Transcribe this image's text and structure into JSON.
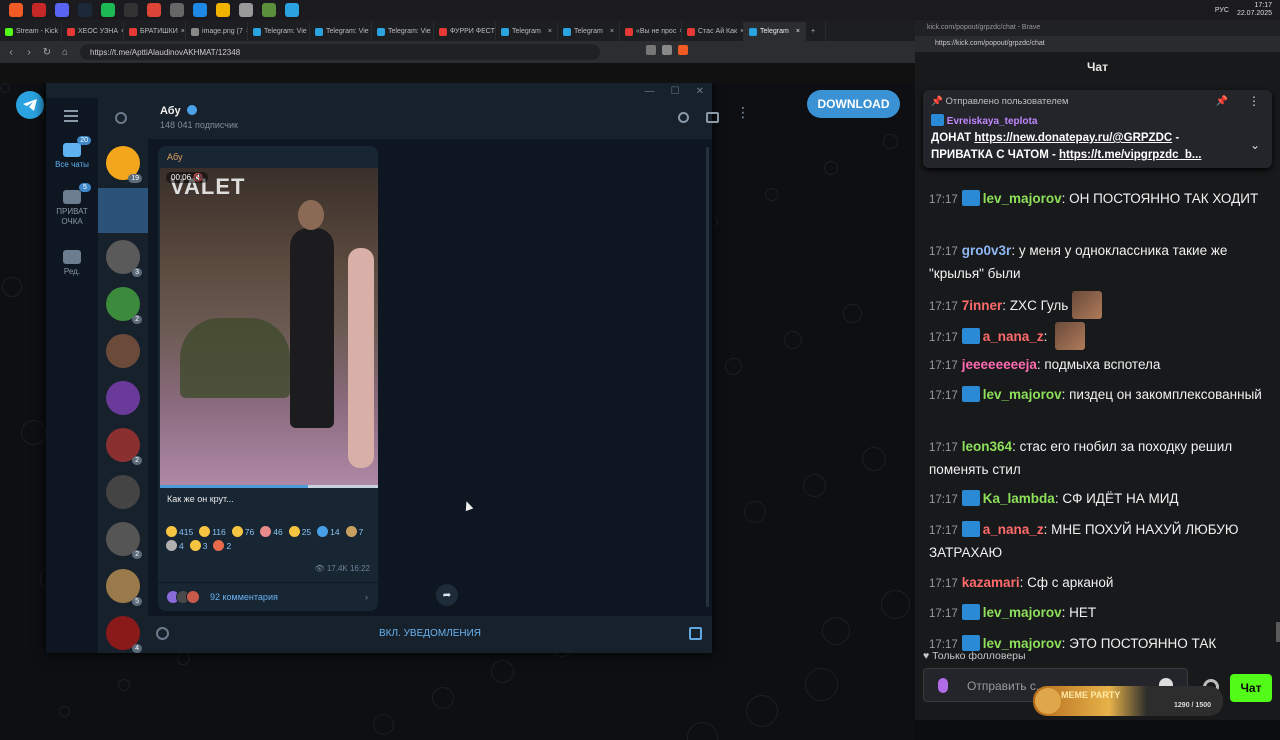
{
  "taskbar": {
    "apps": [
      {
        "name": "brave",
        "color": "#f05a24"
      },
      {
        "name": "gmail",
        "color": "#c62828"
      },
      {
        "name": "discord",
        "color": "#5865f2"
      },
      {
        "name": "steam",
        "color": "#1b2838"
      },
      {
        "name": "spotify",
        "color": "#1db954"
      },
      {
        "name": "obs",
        "color": "#333"
      },
      {
        "name": "chrome",
        "color": "#db4437"
      },
      {
        "name": "game",
        "color": "#666"
      },
      {
        "name": "bluetooth",
        "color": "#1e88e5"
      },
      {
        "name": "folder",
        "color": "#f0b400"
      },
      {
        "name": "explorer",
        "color": "#999"
      },
      {
        "name": "minecraft",
        "color": "#5b8f3b"
      },
      {
        "name": "telegram",
        "color": "#2aa3e0"
      }
    ],
    "lang": "РУС",
    "time": "17:17",
    "date": "22.07.2025"
  },
  "browser_left": {
    "tabs": [
      {
        "label": "Stream - Kick",
        "color": "#53fc18",
        "active": false
      },
      {
        "label": "ХЕОС УЗНА",
        "color": "#e53935",
        "active": false
      },
      {
        "label": "БРАТИШКИ",
        "color": "#e53935",
        "active": false
      },
      {
        "label": "image.png (7",
        "color": "#888",
        "active": false
      },
      {
        "label": "Telegram: Vie",
        "color": "#2aa3e0",
        "active": false
      },
      {
        "label": "Telegram: Vie",
        "color": "#2aa3e0",
        "active": false
      },
      {
        "label": "Telegram: Vie",
        "color": "#2aa3e0",
        "active": false
      },
      {
        "label": "ФУРРИ ФЕСТ",
        "color": "#e53935",
        "active": false
      },
      {
        "label": "Telegram",
        "color": "#2aa3e0",
        "active": false
      },
      {
        "label": "Telegram",
        "color": "#2aa3e0",
        "active": false
      },
      {
        "label": "«Вы не прос",
        "color": "#e53935",
        "active": false
      },
      {
        "label": "Стас Ай Как",
        "color": "#e53935",
        "active": false
      },
      {
        "label": "Telegram",
        "color": "#2aa3e0",
        "active": true
      }
    ],
    "url": "https://t.me/ApttiAlaudinovAKHMAT/12348"
  },
  "telegram": {
    "download_label": "DOWNLOAD",
    "folders": [
      {
        "label": "Все чаты",
        "badge": "20"
      },
      {
        "label": "ПРИВАТ ОЧКА",
        "badge": "5"
      },
      {
        "label": "Ред.",
        "badge": ""
      }
    ],
    "chat_badges": [
      "19",
      "",
      "3",
      "2",
      "",
      "",
      "2",
      "",
      "2",
      "5",
      "4"
    ],
    "chat_colors": [
      "#f3a51c",
      "#3b3b3b",
      "#5a5a5a",
      "#3c8a3c",
      "#6b4a3a",
      "#6a3a9a",
      "#8a3030",
      "#444",
      "#555",
      "#9a7a4a",
      "#8a1a1a"
    ],
    "channel_title": "Абу",
    "channel_subtitle": "148 041 подписчик",
    "post_author": "Абу",
    "video_sign": "VALET",
    "video_time": "00:06",
    "video_progress": 0.68,
    "post_text": "Как же он крут...",
    "reactions": [
      {
        "count": "415",
        "color": "#f5c542"
      },
      {
        "count": "116",
        "color": "#f5c542"
      },
      {
        "count": "76",
        "color": "#f5c542"
      },
      {
        "count": "46",
        "color": "#e88a8a"
      },
      {
        "count": "25",
        "color": "#f5c542"
      },
      {
        "count": "14",
        "color": "#4aa0e8"
      },
      {
        "count": "7",
        "color": "#c8a060"
      },
      {
        "count": "4",
        "color": "#b0b0b0"
      },
      {
        "count": "3",
        "color": "#f5c542"
      },
      {
        "count": "2",
        "color": "#e86a4a"
      }
    ],
    "views": "17.4K",
    "post_time": "16:22",
    "comments_label": "92 комментария",
    "notify_label": "ВКЛ. УВЕДОМЛЕНИЯ"
  },
  "browser_right": {
    "title": "kick.com/popout/grpzdc/chat - Brave",
    "url": "https://kick.com/popout/grpzdc/chat"
  },
  "kick": {
    "heading": "Чат",
    "pinned_by": "Отправлено пользователем",
    "pinned_user": "Evreiskaya_teplota",
    "pinned_line1_prefix": "ДОНАТ ",
    "pinned_line1_link": "https://new.donatepay.ru/@GRPZDC",
    "pinned_line1_suffix": " -",
    "pinned_line2_prefix": "ПРИВАТКА С ЧАТОМ - ",
    "pinned_line2_link": "https://t.me/vipgrpzdc_b...",
    "messages": [
      {
        "time": "17:17",
        "user": "lev_majorov",
        "color": "#8ee05a",
        "badge": true,
        "text": "ОН ПОСТОЯННО ТАК ХОДИТ",
        "emote": false
      },
      {
        "time": "17:17",
        "user": "gro0v3r",
        "color": "#8fb8f5",
        "badge": false,
        "text": "у меня у одноклассника такие же \"крылья\" были",
        "emote": false
      },
      {
        "time": "17:17",
        "user": "7inner",
        "color": "#ff6b6b",
        "badge": false,
        "text": "ZXC Гуль",
        "emote": true
      },
      {
        "time": "17:17",
        "user": "a_nana_z",
        "color": "#ff6b6b",
        "badge": true,
        "text": "",
        "emote": true
      },
      {
        "time": "17:17",
        "user": "jeeeeeeeeja",
        "color": "#ff6bb0",
        "badge": false,
        "text": "подмыха вспотела",
        "emote": false
      },
      {
        "time": "17:17",
        "user": "lev_majorov",
        "color": "#8ee05a",
        "badge": true,
        "text": "пиздец он закомплексованный",
        "emote": false
      },
      {
        "time": "17:17",
        "user": "leon364",
        "color": "#8ee05a",
        "badge": false,
        "text": "стас его гнобил за походку решил поменять стил",
        "emote": false
      },
      {
        "time": "17:17",
        "user": "Ka_lambda",
        "color": "#8ee05a",
        "badge": true,
        "text": "СФ ИДЁТ НА МИД",
        "emote": false
      },
      {
        "time": "17:17",
        "user": "a_nana_z",
        "color": "#ff6b6b",
        "badge": true,
        "text": "МНЕ ПОХУЙ НАХУЙ ЛЮБУЮ ЗАТРАХАЮ",
        "emote": false
      },
      {
        "time": "17:17",
        "user": "kazamari",
        "color": "#ff6b6b",
        "badge": false,
        "text": "Сф с арканой",
        "emote": false
      },
      {
        "time": "17:17",
        "user": "lev_majorov",
        "color": "#8ee05a",
        "badge": true,
        "text": "НЕТ",
        "emote": false
      },
      {
        "time": "17:17",
        "user": "lev_majorov",
        "color": "#8ee05a",
        "badge": true,
        "text": "ЭТО ПОСТОЯННО ТАК",
        "emote": false
      }
    ],
    "followers_only": "Только фолловеры",
    "input_placeholder": "Отправить с...",
    "meme_party_label": "MEME PARTY",
    "meme_party_count": "1290 / 1500",
    "send_label": "Чат"
  }
}
